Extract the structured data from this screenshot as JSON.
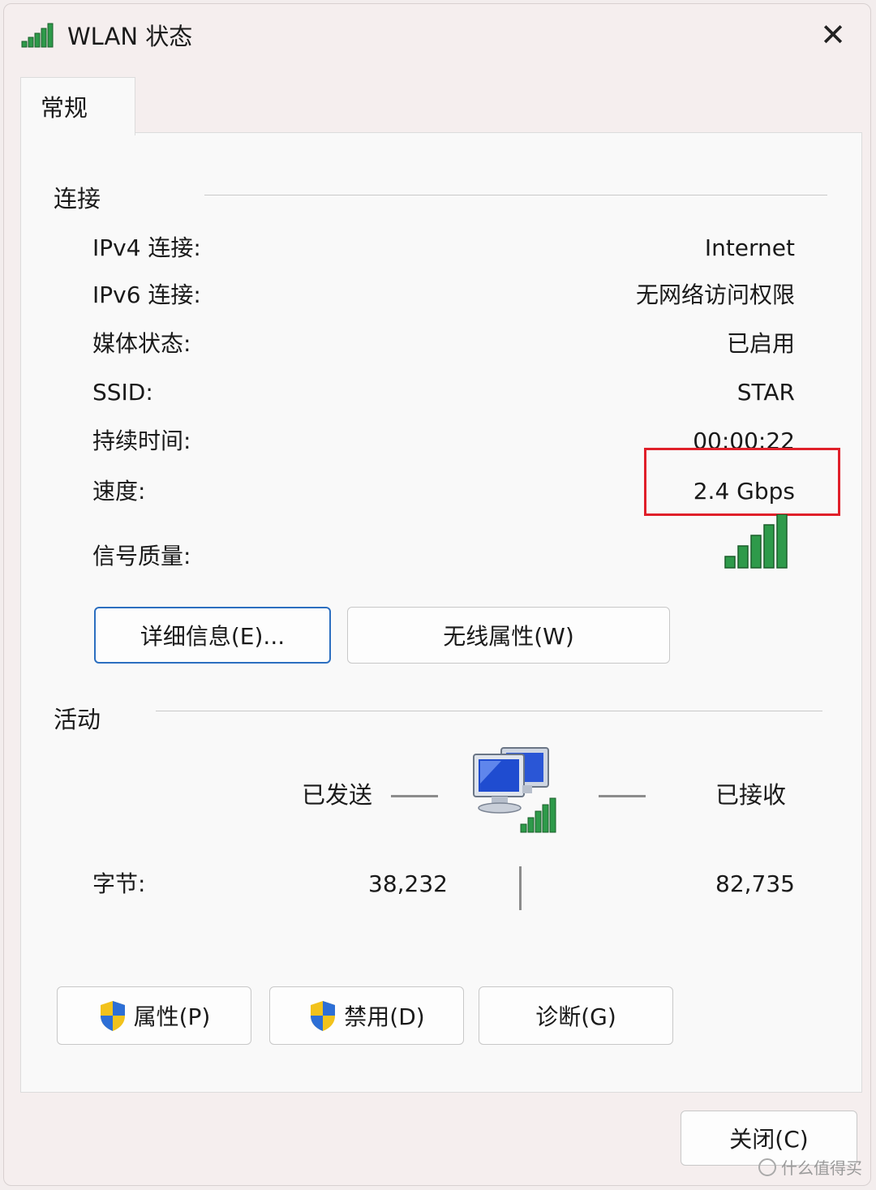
{
  "window": {
    "title": "WLAN 状态",
    "icons": {
      "title": "wifi-signal-icon",
      "close": "close-icon"
    }
  },
  "tabs": [
    {
      "label": "常规",
      "selected": true
    }
  ],
  "connection": {
    "heading": "连接",
    "rows": [
      {
        "label": "IPv4 连接:",
        "value": "Internet"
      },
      {
        "label": "IPv6 连接:",
        "value": "无网络访问权限"
      },
      {
        "label": "媒体状态:",
        "value": "已启用"
      },
      {
        "label": "SSID:",
        "value": "STAR"
      },
      {
        "label": "持续时间:",
        "value": "00:00:22"
      },
      {
        "label": "速度:",
        "value": "2.4 Gbps"
      }
    ],
    "signal_label": "信号质量:",
    "signal_bars": 5,
    "signal_bars_max": 5,
    "highlight_color": "#e0202a",
    "details_button": "详细信息(E)...",
    "wireless_button": "无线属性(W)"
  },
  "activity": {
    "heading": "活动",
    "sent_label": "已发送",
    "received_label": "已接收",
    "bytes_label": "字节:",
    "bytes_sent": "38,232",
    "bytes_received": "82,735"
  },
  "actions": {
    "properties": "属性(P)",
    "disable": "禁用(D)",
    "diagnose": "诊断(G)",
    "shield_icon": "uac-shield-icon"
  },
  "close_button": "关闭(C)",
  "watermark": "什么值得买",
  "colors": {
    "accent": "#2c6fc0",
    "signal": "#2e9a4a"
  }
}
